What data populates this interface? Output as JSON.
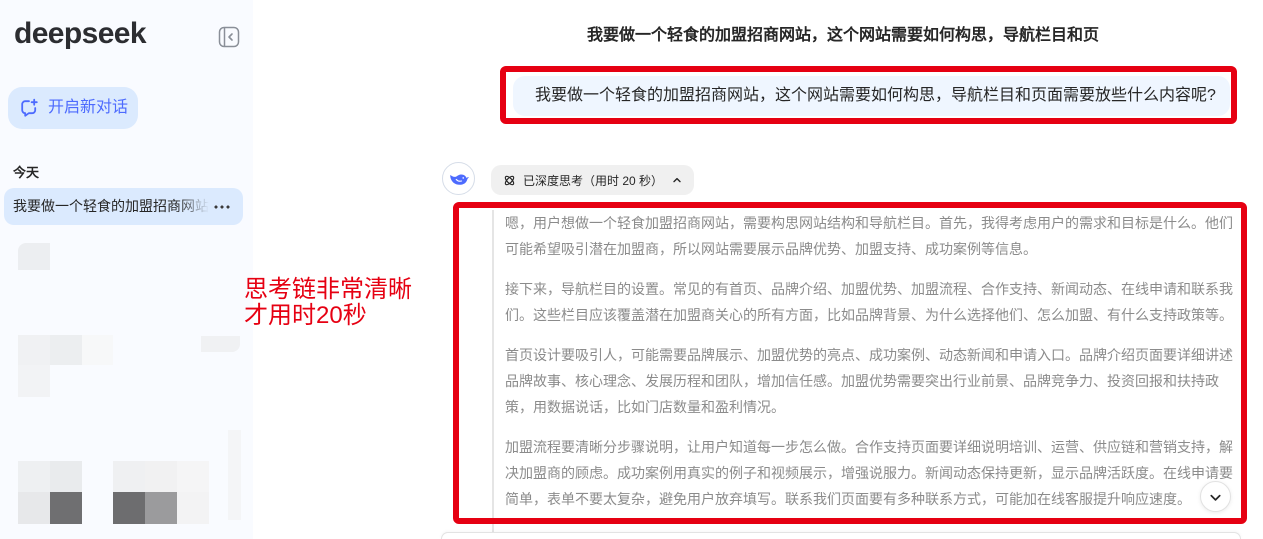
{
  "app": {
    "logo_text": "deepseek",
    "colors": {
      "accent": "#4d6bfe",
      "sidebar_bg": "#f9fbff",
      "selected_bg": "#dbeafe",
      "user_bubble": "#eff6ff",
      "thinking_text": "#8b8b8b",
      "annotation_red": "#e60012"
    }
  },
  "sidebar": {
    "collapse_icon": "collapse-sidebar-icon",
    "new_chat": {
      "icon": "new-chat-icon",
      "label": "开启新对话"
    },
    "history": [
      {
        "group": "今天",
        "items": [
          {
            "title": "我要做一个轻食的加盟招商网站",
            "selected": true,
            "more_icon": "more-horizontal-icon"
          }
        ]
      }
    ]
  },
  "chat": {
    "title": "我要做一个轻食的加盟招商网站，这个网站需要如何构思，导航栏目和页",
    "user_message": "我要做一个轻食的加盟招商网站，这个网站需要如何构思，导航栏目和页面需要放些什么内容呢?",
    "assistant": {
      "avatar_icon": "deepseek-whale-icon",
      "thinking_toggle": {
        "icon": "deep-think-icon",
        "label": "已深度思考（用时 20 秒）",
        "expanded": true,
        "chevron_icon": "chevron-up-icon"
      },
      "thinking_paragraphs": [
        "嗯，用户想做一个轻食加盟招商网站，需要构思网站结构和导航栏目。首先，我得考虑用户的需求和目标是什么。他们可能希望吸引潜在加盟商，所以网站需要展示品牌优势、加盟支持、成功案例等信息。",
        "接下来，导航栏目的设置。常见的有首页、品牌介绍、加盟优势、加盟流程、合作支持、新闻动态、在线申请和联系我们。这些栏目应该覆盖潜在加盟商关心的所有方面，比如品牌背景、为什么选择他们、怎么加盟、有什么支持政策等。",
        "首页设计要吸引人，可能需要品牌展示、加盟优势的亮点、成功案例、动态新闻和申请入口。品牌介绍页面要详细讲述品牌故事、核心理念、发展历程和团队，增加信任感。加盟优势需要突出行业前景、品牌竞争力、投资回报和扶持政策，用数据说话，比如门店数量和盈利情况。",
        "加盟流程要清晰分步骤说明，让用户知道每一步怎么做。合作支持页面要详细说明培训、运营、供应链和营销支持，解决加盟商的顾虑。成功案例用真实的例子和视频展示，增强说服力。新闻动态保持更新，显示品牌活跃度。在线申请要简单，表单不要太复杂，避免用户放弃填写。联系我们页面要有多种联系方式，可能加在线客服提升响应速度。"
      ]
    },
    "scroll_down_icon": "chevron-down-icon"
  },
  "annotation": {
    "lines": [
      "思考链非常清晰",
      "才用时20秒"
    ]
  }
}
